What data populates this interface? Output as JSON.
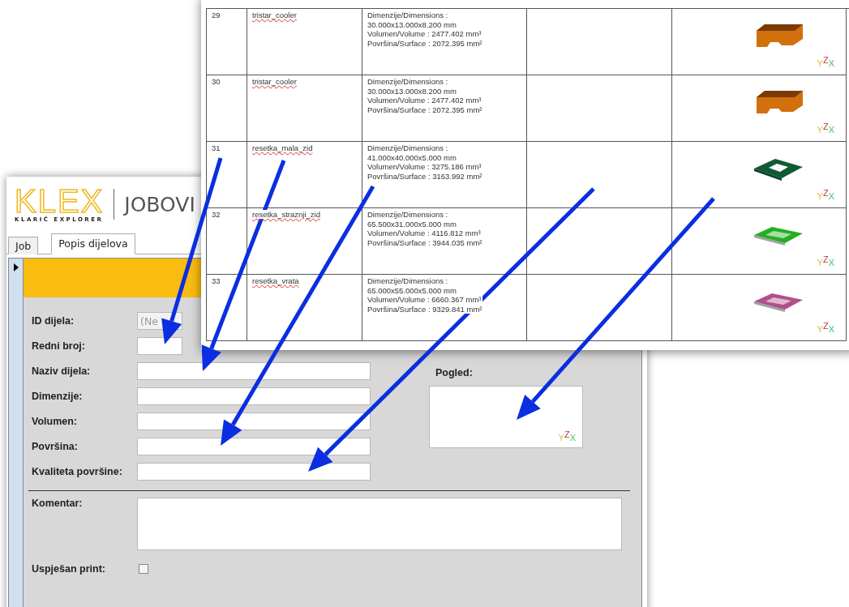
{
  "form": {
    "logo": {
      "mark": "KLEX",
      "subtitle": "KLARIĆ EXPLORER"
    },
    "title": "JOBOVI",
    "tabs": [
      {
        "label": "Job",
        "selected": false
      },
      {
        "label": "Popis dijelova",
        "selected": true
      }
    ],
    "fields": [
      {
        "label": "ID dijela:",
        "value": "(Ne",
        "disabled": true
      },
      {
        "label": "Redni broj:",
        "disabled": false
      },
      {
        "label": "Naziv dijela:",
        "disabled": false
      },
      {
        "label": "Dimenzije:",
        "disabled": false
      },
      {
        "label": "Volumen:",
        "disabled": false
      },
      {
        "label": "Površina:",
        "disabled": false
      },
      {
        "label": "Kvaliteta površine:",
        "disabled": false
      }
    ],
    "preview": {
      "label": "Pogled:",
      "axes": {
        "y": "Y",
        "z": "Z",
        "x": "X"
      }
    },
    "comment": {
      "label": "Komentar:"
    },
    "print": {
      "label": "Uspješan print:",
      "checked": false
    }
  },
  "report": {
    "rows": [
      {
        "number": "29",
        "name": "tristar_cooler",
        "misspelled": true,
        "details": [
          "Dimenzije/Dimensions :",
          "30.000x13.000x8.200 mm",
          "Volumen/Volume : 2477.402 mm³",
          "Površina/Surface : 2072.395 mm²"
        ],
        "model": {
          "kind": "block",
          "color": "#d2700e"
        },
        "axes": {
          "y": "Y",
          "z": "Z",
          "x": "X"
        }
      },
      {
        "number": "30",
        "name": "tristar_cooler",
        "misspelled": true,
        "details": [
          "Dimenzije/Dimensions :",
          "30.000x13.000x8.200 mm",
          "Volumen/Volume : 2477.402 mm³",
          "Površina/Surface : 2072.395 mm²"
        ],
        "model": {
          "kind": "block",
          "color": "#d2700e"
        },
        "axes": {
          "y": "Y",
          "z": "Z",
          "x": "X"
        }
      },
      {
        "number": "31",
        "name": "resetka_mala_zid",
        "misspelled": true,
        "details": [
          "Dimenzije/Dimensions :",
          "41.000x40.000x5.000 mm",
          "Volumen/Volume : 3275.186 mm³",
          "Površina/Surface : 3163.992 mm²"
        ],
        "model": {
          "kind": "frame",
          "color": "#0f5a35"
        },
        "axes": {
          "y": "Y",
          "z": "Z",
          "x": "X"
        }
      },
      {
        "number": "32",
        "name": "resetka_straznji_zid",
        "misspelled": true,
        "details": [
          "Dimenzije/Dimensions :",
          "65.500x31.000x5.000 mm",
          "Volumen/Volume : 4116.812 mm³",
          "Površina/Surface : 3944.035 mm²"
        ],
        "model": {
          "kind": "tray",
          "color": "#22b022"
        },
        "axes": {
          "y": "Y",
          "z": "Z",
          "x": "X"
        }
      },
      {
        "number": "33",
        "name": "resetka_vrata",
        "misspelled": true,
        "details": [
          "Dimenzije/Dimensions :",
          "65.000x55.000x5.000 mm",
          "Volumen/Volume : 6660.367 mm³",
          "Površina/Surface : 9329.841 mm²"
        ],
        "model": {
          "kind": "tray",
          "color": "#b0508a"
        },
        "axes": {
          "y": "Y",
          "z": "Z",
          "x": "X"
        }
      }
    ]
  }
}
